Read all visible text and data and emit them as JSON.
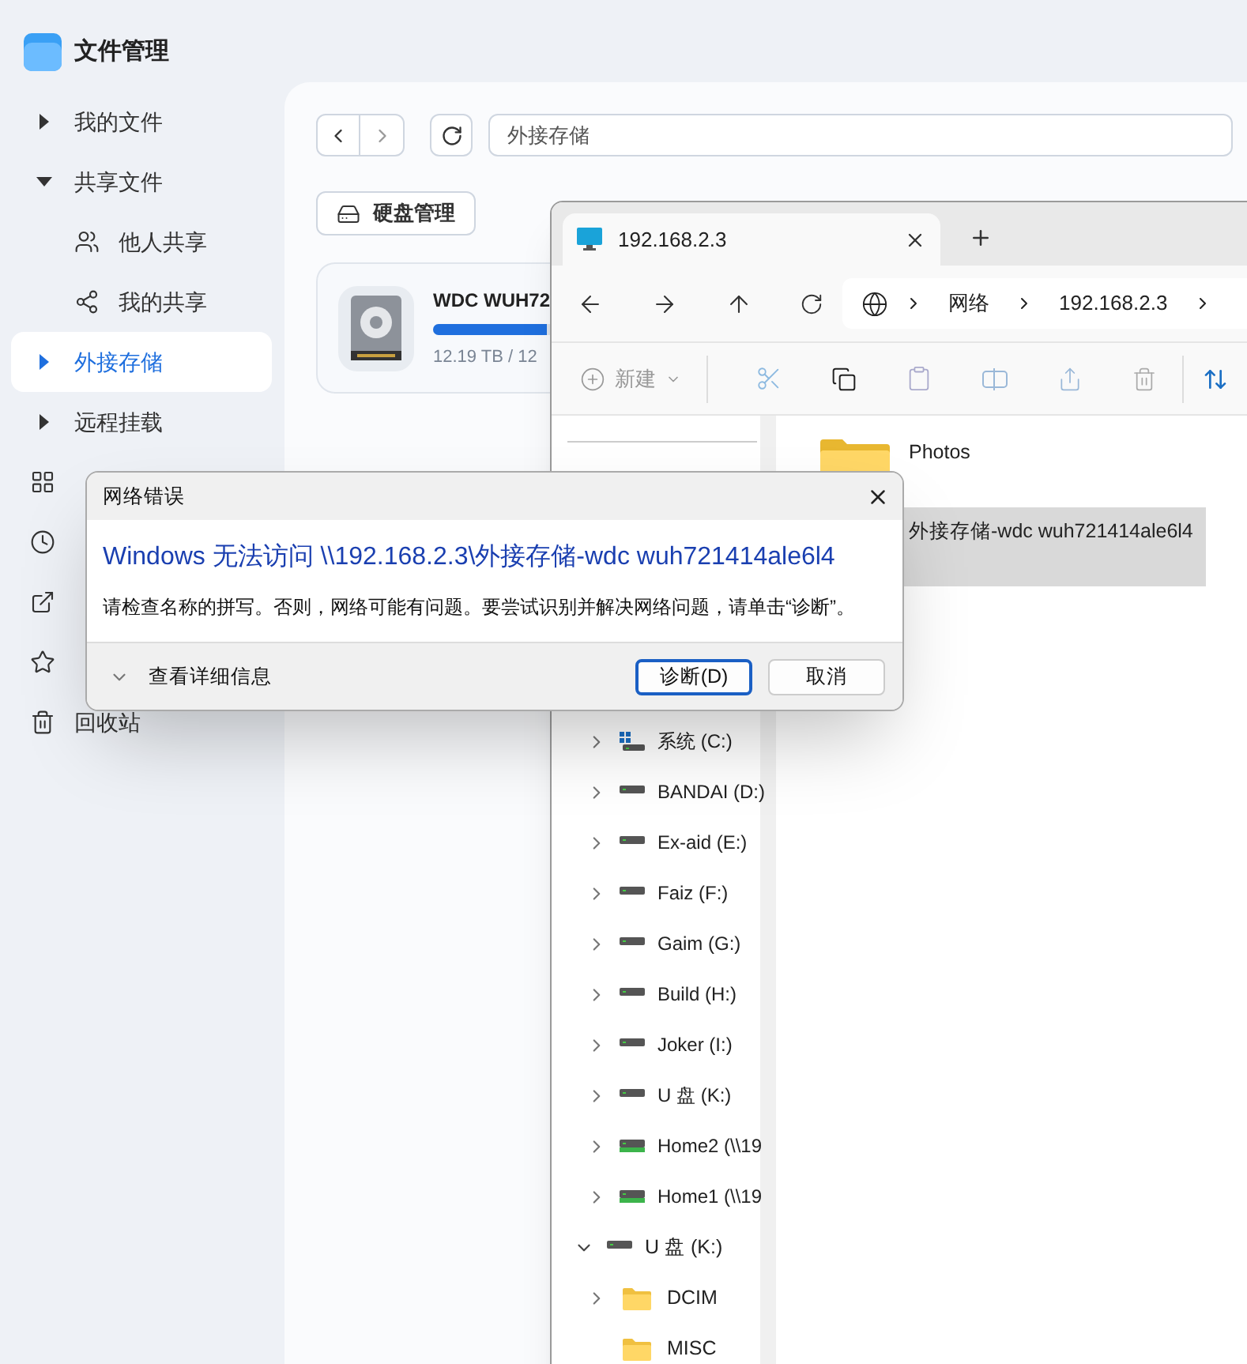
{
  "app": {
    "title": "文件管理"
  },
  "sidebar": {
    "items": [
      {
        "label": "我的文件",
        "kind": "group",
        "expanded": false,
        "selected": false
      },
      {
        "label": "共享文件",
        "kind": "group",
        "expanded": true,
        "selected": false
      },
      {
        "label": "他人共享",
        "kind": "people",
        "selected": false
      },
      {
        "label": "我的共享",
        "kind": "share",
        "selected": false
      },
      {
        "label": "外接存储",
        "kind": "group",
        "expanded": false,
        "selected": true
      },
      {
        "label": "远程挂载",
        "kind": "group",
        "expanded": false,
        "selected": false
      },
      {
        "kind": "apps",
        "selected": false
      },
      {
        "kind": "clock",
        "selected": false
      },
      {
        "kind": "external",
        "selected": false
      },
      {
        "kind": "star",
        "selected": false
      },
      {
        "label": "回收站",
        "kind": "trash",
        "selected": false
      }
    ]
  },
  "main": {
    "path": "外接存储",
    "disk_button": "硬盘管理",
    "disk": {
      "name": "WDC WUH72",
      "level": 0.97,
      "usage": "12.19 TB / 12"
    }
  },
  "explorer": {
    "tab": "192.168.2.3",
    "breadcrumb": [
      "网络",
      "192.168.2.3"
    ],
    "new_label": "新建",
    "drives": [
      {
        "label": "系统 (C:)",
        "kind": "system"
      },
      {
        "label": "BANDAI (D:)",
        "kind": "drive"
      },
      {
        "label": "Ex-aid (E:)",
        "kind": "drive"
      },
      {
        "label": "Faiz (F:)",
        "kind": "drive"
      },
      {
        "label": "Gaim (G:)",
        "kind": "drive"
      },
      {
        "label": "Build (H:)",
        "kind": "drive"
      },
      {
        "label": "Joker (I:)",
        "kind": "drive"
      },
      {
        "label": "U 盘 (K:)",
        "kind": "drive"
      },
      {
        "label": "Home2 (\\\\19",
        "kind": "network"
      },
      {
        "label": "Home1 (\\\\19",
        "kind": "network"
      }
    ],
    "tree": [
      {
        "label": "U 盘 (K:)",
        "expanded": true,
        "children": [
          {
            "label": "DCIM",
            "expandable": true
          },
          {
            "label": "MISC",
            "expandable": false
          }
        ]
      }
    ],
    "files": [
      {
        "name": "Photos",
        "selected": false
      },
      {
        "name": "外接存储-wdc wuh721414ale6l4",
        "selected": true
      }
    ]
  },
  "dialog": {
    "title": "网络错误",
    "heading": "Windows 无法访问 \\\\192.168.2.3\\外接存储-wdc wuh721414ale6l4",
    "message": "请检查名称的拼写。否则，网络可能有问题。要尝试识别并解决网络问题，请单击“诊断”。",
    "details": "查看详细信息",
    "buttons": [
      {
        "label": "诊断(D)",
        "default": true
      },
      {
        "label": "取消",
        "default": false
      }
    ]
  }
}
